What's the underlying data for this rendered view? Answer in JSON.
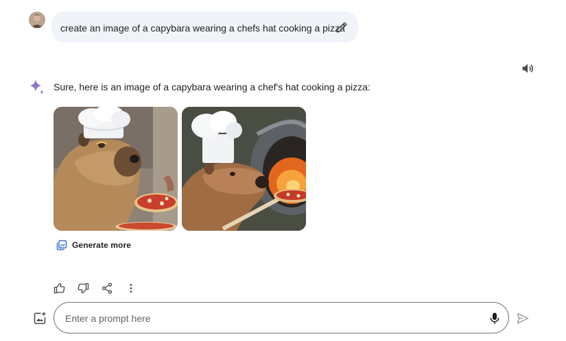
{
  "user_message": {
    "text": "create an image of a capybara wearing a chefs hat cooking a pizza",
    "avatar": "user-avatar",
    "edit_icon": "pencil-icon"
  },
  "response": {
    "speaker_icon": "speaker-icon",
    "assistant_icon": "sparkle-icon",
    "text": "Sure, here is an image of a capybara wearing a chef's hat cooking a pizza:",
    "images": [
      {
        "name": "capybara-chef-image-1"
      },
      {
        "name": "capybara-chef-image-2"
      }
    ],
    "generate_more_label": "Generate more"
  },
  "actions": [
    "thumbs-up-icon",
    "thumbs-down-icon",
    "share-icon",
    "more-vert-icon"
  ],
  "input": {
    "placeholder": "Enter a prompt here",
    "value": ""
  },
  "colors": {
    "bubble": "#f0f4f9",
    "text": "#1f1f1f",
    "icon": "#444746",
    "accent_blue": "#4285f4",
    "border": "#747775"
  }
}
